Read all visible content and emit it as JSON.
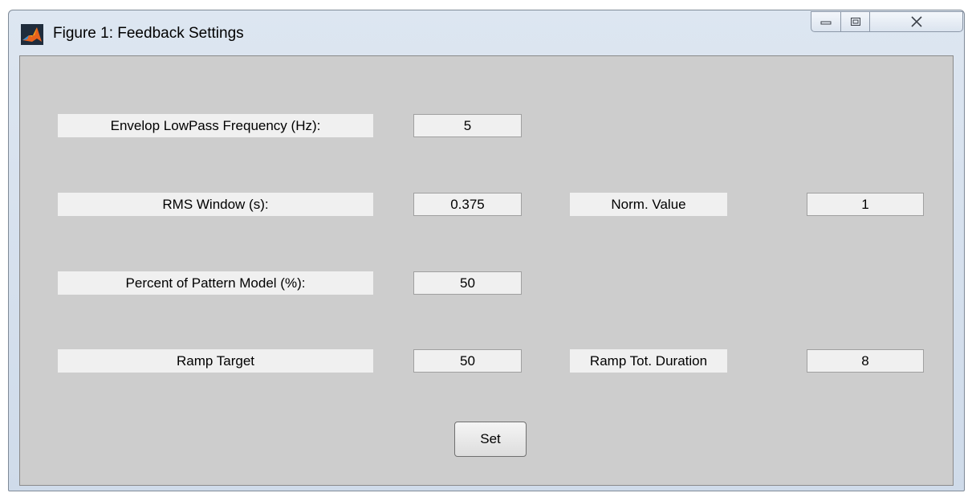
{
  "window": {
    "title": "Figure 1: Feedback Settings",
    "icon": "matlab-logo-icon",
    "controls": [
      "minimize-icon",
      "maximize-icon",
      "close-icon"
    ]
  },
  "form": {
    "envelop_lowpass": {
      "label": "Envelop LowPass Frequency (Hz):",
      "value": "5"
    },
    "rms_window": {
      "label": "RMS Window (s):",
      "value": "0.375"
    },
    "norm_value": {
      "label": "Norm. Value",
      "value": "1"
    },
    "percent_pattern": {
      "label": "Percent of Pattern Model (%):",
      "value": "50"
    },
    "ramp_target": {
      "label": "Ramp Target",
      "value": "50"
    },
    "ramp_duration": {
      "label": "Ramp Tot. Duration",
      "value": "8"
    },
    "set_label": "Set"
  },
  "colors": {
    "panel_background": "#cdcdcd",
    "label_background": "#f0f0f0",
    "window_frame": "#cfdbea"
  }
}
